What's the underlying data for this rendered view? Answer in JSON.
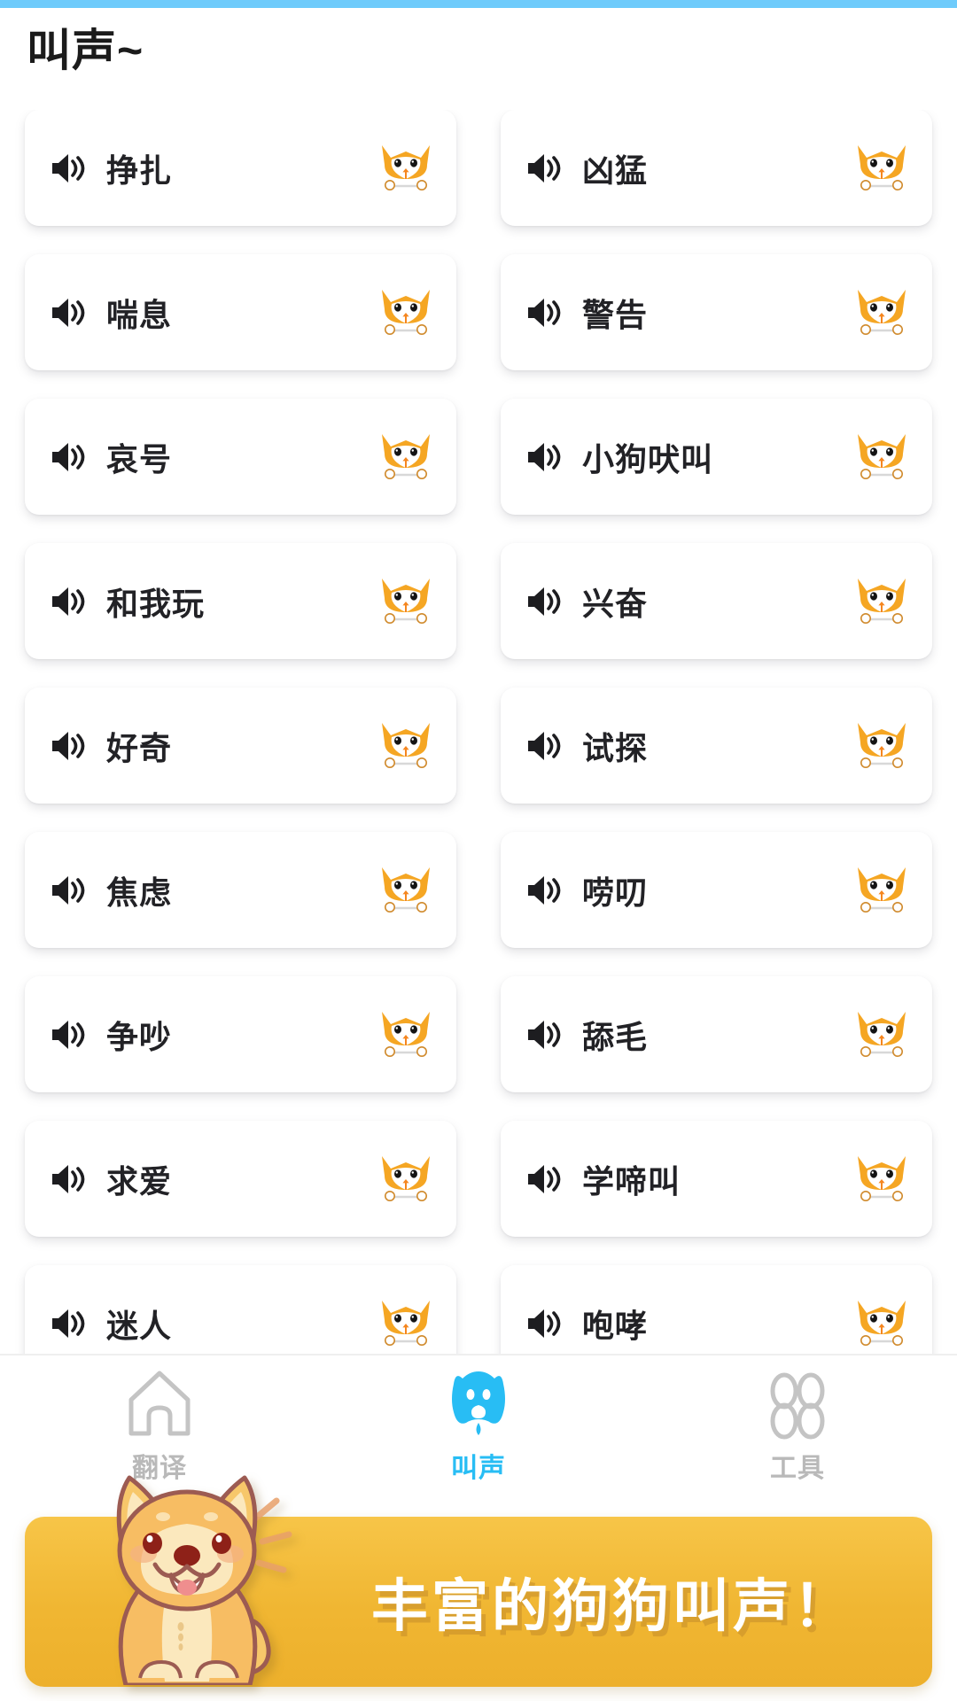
{
  "status_bar": {
    "accent_color": "#6ecbfb"
  },
  "header": {
    "title": "叫声~"
  },
  "theme": {
    "active_color": "#28bdf4",
    "inactive_color": "#b9b9b9",
    "banner_color": "#f0b632",
    "dog_fur_color": "#f5a623",
    "card_background": "#ffffff"
  },
  "sounds": [
    {
      "label": "挣扎",
      "speaker_icon": "speaker-icon",
      "dog_icon": "dog-face-icon"
    },
    {
      "label": "凶猛",
      "speaker_icon": "speaker-icon",
      "dog_icon": "dog-face-icon"
    },
    {
      "label": "喘息",
      "speaker_icon": "speaker-icon",
      "dog_icon": "dog-face-icon"
    },
    {
      "label": "警告",
      "speaker_icon": "speaker-icon",
      "dog_icon": "dog-face-icon"
    },
    {
      "label": "哀号",
      "speaker_icon": "speaker-icon",
      "dog_icon": "dog-face-icon"
    },
    {
      "label": "小狗吠叫",
      "speaker_icon": "speaker-icon",
      "dog_icon": "dog-face-icon"
    },
    {
      "label": "和我玩",
      "speaker_icon": "speaker-icon",
      "dog_icon": "dog-face-icon"
    },
    {
      "label": "兴奋",
      "speaker_icon": "speaker-icon",
      "dog_icon": "dog-face-icon"
    },
    {
      "label": "好奇",
      "speaker_icon": "speaker-icon",
      "dog_icon": "dog-face-icon"
    },
    {
      "label": "试探",
      "speaker_icon": "speaker-icon",
      "dog_icon": "dog-face-icon"
    },
    {
      "label": "焦虑",
      "speaker_icon": "speaker-icon",
      "dog_icon": "dog-face-icon"
    },
    {
      "label": "唠叨",
      "speaker_icon": "speaker-icon",
      "dog_icon": "dog-face-icon"
    },
    {
      "label": "争吵",
      "speaker_icon": "speaker-icon",
      "dog_icon": "dog-face-icon"
    },
    {
      "label": "舔毛",
      "speaker_icon": "speaker-icon",
      "dog_icon": "dog-face-icon"
    },
    {
      "label": "求爱",
      "speaker_icon": "speaker-icon",
      "dog_icon": "dog-face-icon"
    },
    {
      "label": "学啼叫",
      "speaker_icon": "speaker-icon",
      "dog_icon": "dog-face-icon"
    },
    {
      "label": "迷人",
      "speaker_icon": "speaker-icon",
      "dog_icon": "dog-face-icon"
    },
    {
      "label": "咆哮",
      "speaker_icon": "speaker-icon",
      "dog_icon": "dog-face-icon"
    }
  ],
  "bottom_nav": {
    "items": [
      {
        "label": "翻译",
        "icon": "house-icon",
        "active": false
      },
      {
        "label": "叫声",
        "icon": "dog-head-icon",
        "active": true
      },
      {
        "label": "工具",
        "icon": "grid-petals-icon",
        "active": false
      }
    ]
  },
  "promo_banner": {
    "text": "丰富的狗狗叫声！",
    "illustration": "shiba-inu-illustration"
  }
}
